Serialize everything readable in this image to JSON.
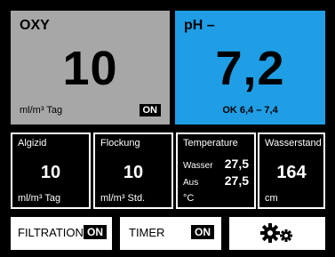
{
  "oxy": {
    "title": "OXY",
    "value": "10",
    "unit": "ml/m³ Tag",
    "status": "ON"
  },
  "ph": {
    "title": "pH –",
    "value": "7,2",
    "status_text": "OK  6,4 – 7,4"
  },
  "algizid": {
    "label": "Algizid",
    "value": "10",
    "unit": "ml/m³ Tag"
  },
  "flockung": {
    "label": "Flockung",
    "value": "10",
    "unit": "ml/m³ Std."
  },
  "temperature": {
    "label": "Temperature",
    "rows": [
      {
        "label": "Wasser",
        "value": "27,5"
      },
      {
        "label": "Aus",
        "value": "27,5"
      }
    ],
    "unit": "°C"
  },
  "wasserstand": {
    "label": "Wasserstand",
    "value": "164",
    "unit": "cm"
  },
  "controls": {
    "filtration_label": "FILTRATION",
    "filtration_state": "ON",
    "timer_label": "TIMER",
    "timer_state": "ON",
    "settings_icon": "gears-icon"
  },
  "colors": {
    "oxy_bg": "#a7a7a7",
    "ph_bg": "#1f9ee6",
    "screen_bg": "#000000",
    "button_bg": "#ffffff"
  }
}
